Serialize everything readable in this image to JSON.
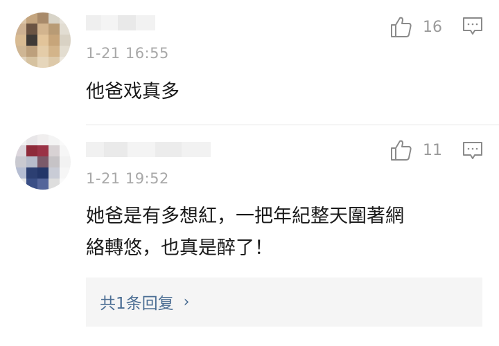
{
  "comments": [
    {
      "timestamp": "1-21 16:55",
      "likes": "16",
      "text": "他爸戏真多",
      "icons": {
        "like": "thumbs-up-icon",
        "reply": "comment-reply-icon"
      }
    },
    {
      "timestamp": "1-21 19:52",
      "likes": "11",
      "text_lines": [
        "她爸是有多想紅，一把年紀整天圍著網",
        "絡轉悠，也真是醉了！"
      ],
      "reply_summary": "共1条回复",
      "icons": {
        "like": "thumbs-up-icon",
        "reply": "comment-reply-icon",
        "expand": "chevron-right-icon"
      }
    }
  ],
  "colors": {
    "timestamp": "#a8a8a8",
    "link": "#4a6d93",
    "reply_bg": "#f5f5f5"
  }
}
